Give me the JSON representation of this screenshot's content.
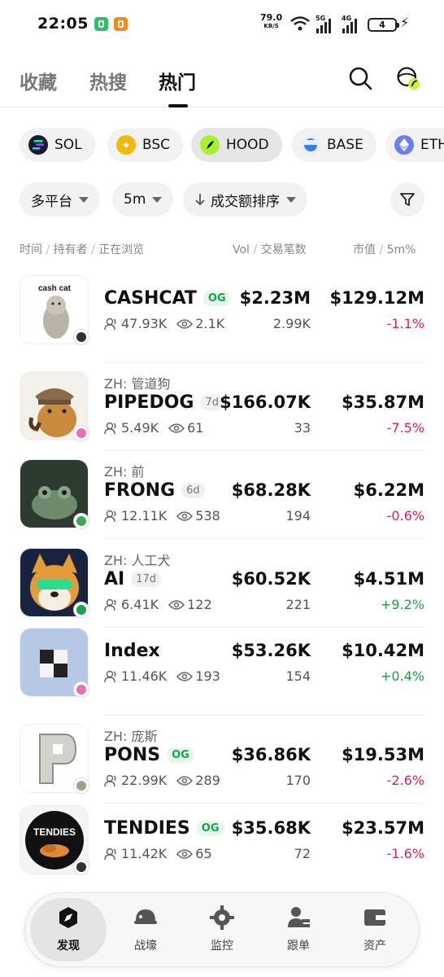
{
  "status_bar": {
    "time": "22:05",
    "net_speed": "79.0",
    "net_unit": "KB/S",
    "sig1": "5G",
    "sig2": "4G",
    "battery": "4"
  },
  "top_tabs": [
    {
      "label": "收藏",
      "active": false
    },
    {
      "label": "热搜",
      "active": false
    },
    {
      "label": "热门",
      "active": true
    }
  ],
  "chains": [
    {
      "label": "SOL",
      "icon": "solana-icon",
      "color": "#1b1b2f",
      "active": false
    },
    {
      "label": "BSC",
      "icon": "bnb-icon",
      "color": "#f0b90b",
      "active": false
    },
    {
      "label": "HOOD",
      "icon": "robinhood-feather-icon",
      "color": "#a7f230",
      "active": true
    },
    {
      "label": "BASE",
      "icon": "base-icon",
      "color": "#3a7bff",
      "active": false
    },
    {
      "label": "ETH",
      "icon": "ethereum-icon",
      "color": "#6b7fe8",
      "active": false
    }
  ],
  "filters": {
    "platform": "多平台",
    "interval": "5m",
    "sort": "成交额排序"
  },
  "columns": {
    "left_1": "时间",
    "left_2": "持有者",
    "left_3": "正在浏览",
    "mid_1": "Vol",
    "mid_2": "交易笔数",
    "right_1": "市值",
    "right_2": "5m%"
  },
  "tokens": [
    {
      "subname": "",
      "ticker": "CASHCAT",
      "tag": "OG",
      "tag_type": "og",
      "holders": "47.93K",
      "viewers": "2.1K",
      "volume": "$2.23M",
      "txns": "2.99K",
      "mcap": "$129.12M",
      "change": "-1.1%",
      "direction": "neg",
      "thumb_text": "cash cat",
      "platform_color": "#333333"
    },
    {
      "subname": "ZH: 管道狗",
      "ticker": "PIPEDOG",
      "tag": "7d",
      "tag_type": "age",
      "holders": "5.49K",
      "viewers": "61",
      "volume": "$166.07K",
      "txns": "33",
      "mcap": "$35.87M",
      "change": "-7.5%",
      "direction": "neg",
      "thumb_text": "",
      "platform_color": "#e86fb8"
    },
    {
      "subname": "ZH: 前",
      "ticker": "FRONG",
      "tag": "6d",
      "tag_type": "age",
      "holders": "12.11K",
      "viewers": "538",
      "volume": "$68.28K",
      "txns": "194",
      "mcap": "$6.22M",
      "change": "-0.6%",
      "direction": "neg",
      "thumb_text": "",
      "platform_color": "#3aa55b"
    },
    {
      "subname": "ZH: 人工犬",
      "ticker": "AI",
      "tag": "17d",
      "tag_type": "age",
      "holders": "6.41K",
      "viewers": "122",
      "volume": "$60.52K",
      "txns": "221",
      "mcap": "$4.51M",
      "change": "+9.2%",
      "direction": "pos",
      "thumb_text": "",
      "platform_color": "#16a34a"
    },
    {
      "subname": "",
      "ticker": "Index",
      "tag": "",
      "tag_type": "none",
      "holders": "11.46K",
      "viewers": "193",
      "volume": "$53.26K",
      "txns": "154",
      "mcap": "$10.42M",
      "change": "+0.4%",
      "direction": "pos",
      "thumb_text": "",
      "platform_color": "#e86fb8"
    },
    {
      "subname": "ZH: 庞斯",
      "ticker": "PONS",
      "tag": "OG",
      "tag_type": "og",
      "holders": "22.99K",
      "viewers": "289",
      "volume": "$36.86K",
      "txns": "170",
      "mcap": "$19.53M",
      "change": "-2.6%",
      "direction": "neg",
      "thumb_text": "",
      "platform_color": "#9aa58a"
    },
    {
      "subname": "",
      "ticker": "TENDIES",
      "tag": "OG",
      "tag_type": "og",
      "holders": "11.42K",
      "viewers": "65",
      "volume": "$35.68K",
      "txns": "72",
      "mcap": "$23.57M",
      "change": "-1.6%",
      "direction": "neg",
      "thumb_text": "TENDIES",
      "platform_color": "#333333"
    }
  ],
  "bottom_nav": [
    {
      "label": "发现",
      "icon": "discover-compass-icon",
      "active": true
    },
    {
      "label": "战壕",
      "icon": "helmet-icon",
      "active": false
    },
    {
      "label": "监控",
      "icon": "monitor-target-icon",
      "active": false
    },
    {
      "label": "跟单",
      "icon": "copy-trade-users-icon",
      "active": false
    },
    {
      "label": "资产",
      "icon": "wallet-icon",
      "active": false
    }
  ],
  "colors": {
    "positive": "#1a9e47",
    "negative": "#d6245a",
    "og_tag": "#16a34a"
  }
}
